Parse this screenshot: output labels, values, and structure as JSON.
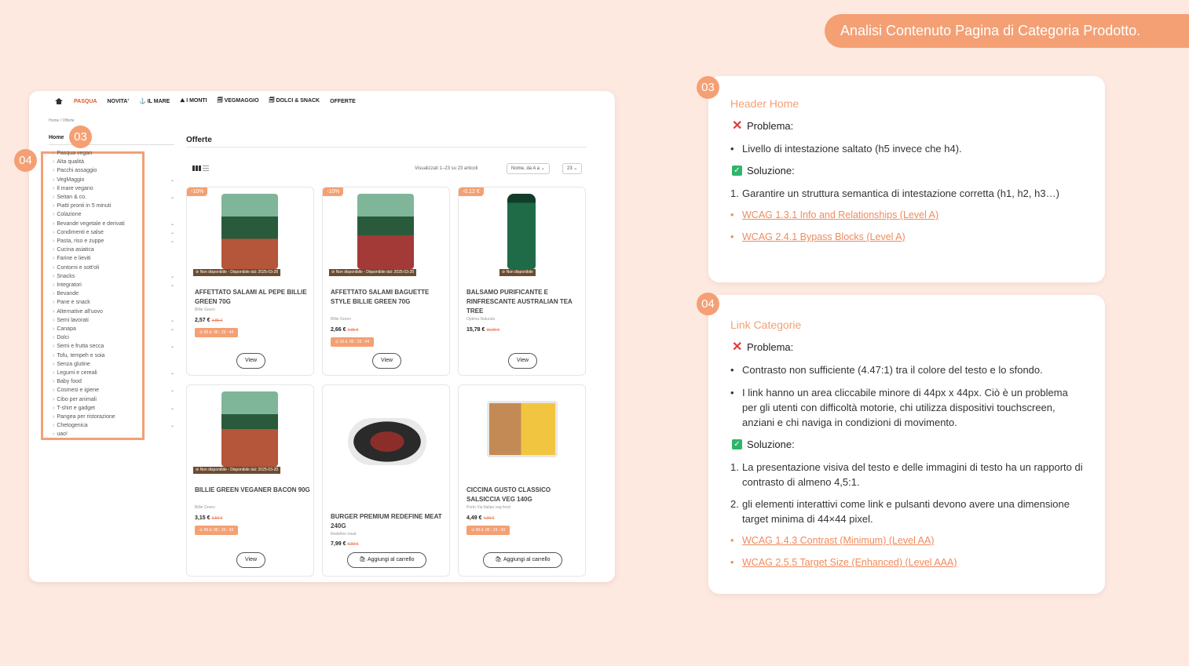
{
  "header_badge": "Analisi Contenuto Pagina di Categoria Prodotto.",
  "markers": {
    "m03": "03",
    "m04": "04"
  },
  "site": {
    "nav": [
      "PASQUA",
      "NOVITA'",
      "IL MARE",
      "I MONTI",
      "VEGMAGGIO",
      "DOLCI & SNACK",
      "OFFERTE"
    ],
    "breadcrumb": "Home  /  Offerte",
    "home_label": "Home",
    "categories": [
      "Pasqua vegan",
      "Alta qualità",
      "Pacchi assaggio",
      "VegMaggio",
      "Il mare vegano",
      "Seitan & co.",
      "Piatti pronti in 5 minuti",
      "Colazione",
      "Bevande vegetale e derivati",
      "Condimenti e salse",
      "Pasta, riso e zuppe",
      "Cucina asiatica",
      "Farine e lieviti",
      "Contorni e sott'oli",
      "Snacks",
      "Integratori",
      "Bevande",
      "Pane e snack",
      "Alternative all'uovo",
      "Semi lavorati",
      "Canapa",
      "Dolci",
      "Semi e frutta secca",
      "Tofu, tempeh e soia",
      "Senza glutine",
      "Legumi e cereali",
      "Baby food",
      "Cosmesi e igiene",
      "Cibo per animali",
      "T-shirt e gadget",
      "Pangea per ristorazione",
      "Chetogenica",
      "uao!"
    ],
    "offers_title": "Offerte",
    "results_text": "Visualizzati 1–23 su 23 articoli",
    "sort_select": "Nome, da A a ⌄",
    "per_page_select": "23 ⌄",
    "products": [
      {
        "discount": "-10%",
        "unavailable": "⊘ Non disponibile - Disponibile dal: 2025-03-28",
        "name": "AFFETTATO SALAMI AL PEPE BILLIE GREEN 70G",
        "brand": "Billie Green",
        "price": "2,57 €",
        "old_price": "2,85 €",
        "timer": "⊙  05 d. 05 : 23 : 44",
        "button": "View"
      },
      {
        "discount": "-10%",
        "unavailable": "⊘ Non disponibile - Disponibile dal: 2025-03-28",
        "name": "AFFETTATO SALAMI BAGUETTE STYLE BILLIE GREEN 70G",
        "brand": "Billie Green",
        "price": "2,66 €",
        "old_price": "2,95 €",
        "timer": "⊙  10 d. 05 : 23 : 44",
        "button": "View"
      },
      {
        "discount": "-0,12 €",
        "unavailable": "⊘ Non disponibile",
        "name": "BALSAMO PURIFICANTE E RINFRESCANTE AUSTRALIAN TEA TREE",
        "brand": "Optima Naturals",
        "price": "15,78 €",
        "old_price": "15,90 €",
        "timer": "",
        "button": "View"
      },
      {
        "discount": "",
        "unavailable": "⊘ Non disponibile - Disponibile dal: 2025-03-28",
        "name": "BILLIE GREEN VEGANER BACON 90G",
        "brand": "Billie Green",
        "price": "3,15 €",
        "old_price": "3,50 €",
        "timer": "⊙  05 d. 05 : 23 : 43",
        "button": "View"
      },
      {
        "discount": "",
        "unavailable": "",
        "name": "BURGER PREMIUM REDEFINE MEAT 240G",
        "brand": "Redefine meat",
        "price": "7,99 €",
        "old_price": "9,99 €",
        "timer": "",
        "button": "Aggiungi al carrello"
      },
      {
        "discount": "",
        "unavailable": "",
        "name": "CICCINA GUSTO CLASSICO SALSICCIA VEG 140G",
        "brand": "Porto Via Italian veg food",
        "price": "4,49 €",
        "old_price": "4,99 €",
        "timer": "⊙  09 d. 05 : 23 : 43",
        "button": "Aggiungi al carrello"
      }
    ]
  },
  "panel1": {
    "number": "03",
    "title": "Header Home",
    "problem_label": "Problema:",
    "problems": [
      "Livello di intestazione saltato (h5 invece che h4)."
    ],
    "solution_label": "Soluzione:",
    "solutions": [
      "Garantire un struttura semantica di intestazione corretta (h1, h2, h3…)"
    ],
    "links": [
      "WCAG 1.3.1 Info and Relationships (Level A)",
      "WCAG 2.4.1 Bypass Blocks (Level A)"
    ]
  },
  "panel2": {
    "number": "04",
    "title": "Link Categorie",
    "problem_label": "Problema:",
    "problems": [
      "Contrasto non sufficiente (4.47:1) tra il colore del testo e lo sfondo.",
      "I link hanno un area cliccabile minore di 44px x 44px. Ciò è un problema per gli utenti con difficoltà motorie, chi utilizza dispositivi touchscreen, anziani e chi naviga in condizioni di movimento."
    ],
    "solution_label": "Soluzione:",
    "solutions": [
      "La presentazione visiva del testo e delle immagini di testo ha un rapporto di contrasto di almeno 4,5:1.",
      "gli elementi interattivi come link e pulsanti devono avere una dimensione target minima di 44×44 pixel."
    ],
    "links": [
      "WCAG 1.4.3 Contrast (Minimum) (Level AA)",
      "WCAG 2.5.5 Target Size (Enhanced) (Level AAA)"
    ]
  }
}
